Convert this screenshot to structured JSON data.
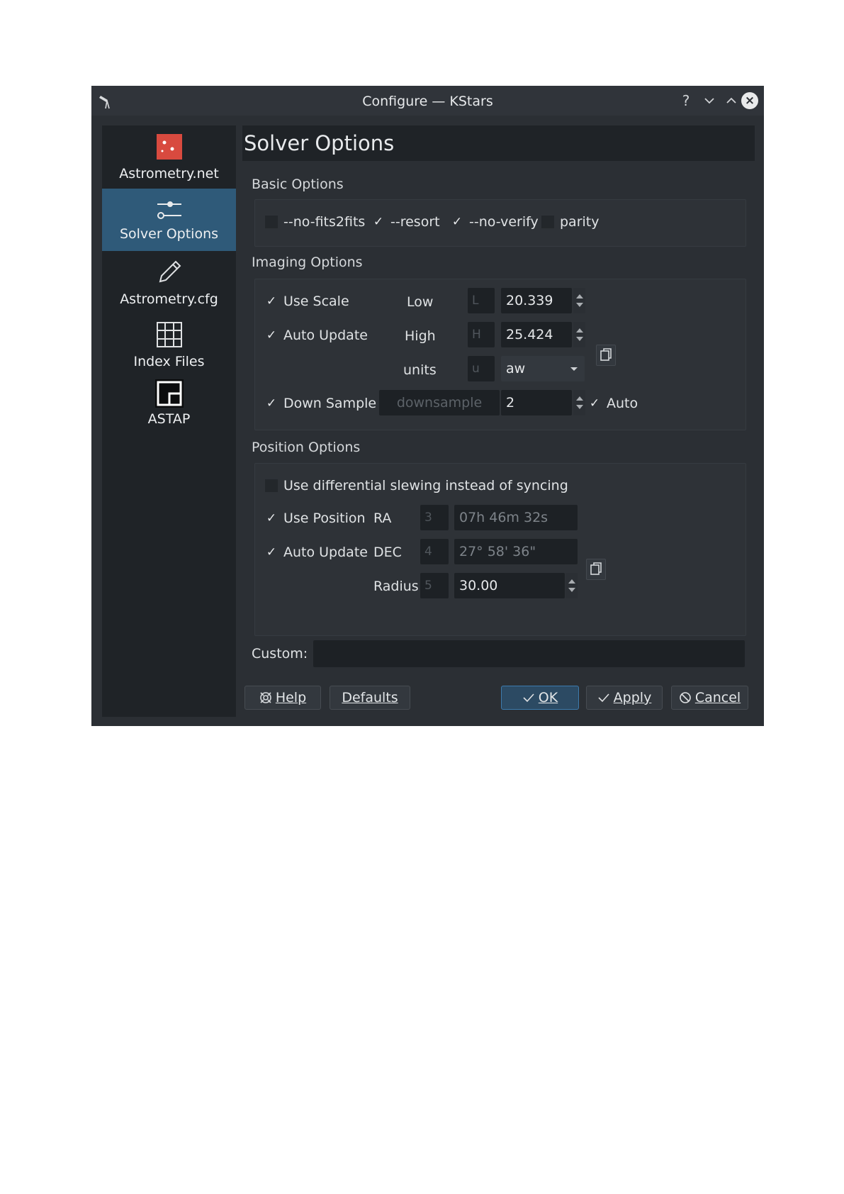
{
  "window": {
    "title": "Configure — KStars"
  },
  "titlebar": {
    "help_glyph": "?",
    "minimize_glyph": "⌄",
    "maximize_glyph": "⌃",
    "close_glyph": "×"
  },
  "sidebar": {
    "items": [
      {
        "label": "Astrometry.net",
        "icon": "astrometry-icon",
        "active": false
      },
      {
        "label": "Solver Options",
        "icon": "sliders-icon",
        "active": true
      },
      {
        "label": "Astrometry.cfg",
        "icon": "pencil-icon",
        "active": false
      },
      {
        "label": "Index Files",
        "icon": "grid-icon",
        "active": false
      },
      {
        "label": "ASTAP",
        "icon": "astap-icon",
        "active": false
      }
    ]
  },
  "page": {
    "title": "Solver Options"
  },
  "basic": {
    "title": "Basic Options",
    "options": [
      {
        "label": "--no-fits2fits",
        "checked": false
      },
      {
        "label": "--resort",
        "checked": true
      },
      {
        "label": "--no-verify",
        "checked": true
      },
      {
        "label": "parity",
        "checked": false
      }
    ]
  },
  "imaging": {
    "title": "Imaging Options",
    "use_scale": {
      "label": "Use Scale",
      "checked": true
    },
    "auto_update": {
      "label": "Auto Update",
      "checked": true
    },
    "down_sample": {
      "label": "Down Sample",
      "checked": true
    },
    "low": {
      "label": "Low",
      "key": "L",
      "value": "20.339"
    },
    "high": {
      "label": "High",
      "key": "H",
      "value": "25.424"
    },
    "units": {
      "label": "units",
      "key": "u",
      "value": "aw"
    },
    "downsample": {
      "placeholder": "downsample",
      "value": "2"
    },
    "auto": {
      "label": "Auto",
      "checked": true
    }
  },
  "position": {
    "title": "Position Options",
    "differential": {
      "label": "Use differential slewing instead of syncing",
      "checked": false
    },
    "use_position": {
      "label": "Use Position",
      "checked": true
    },
    "auto_update": {
      "label": "Auto Update",
      "checked": true
    },
    "ra": {
      "label": "RA",
      "key": "3",
      "value": "07h 46m 32s"
    },
    "dec": {
      "label": "DEC",
      "key": "4",
      "value": "27° 58' 36\""
    },
    "radius": {
      "label": "Radius",
      "key": "5",
      "value": "30.00"
    }
  },
  "custom": {
    "label": "Custom:",
    "value": ""
  },
  "buttons": {
    "help": "Help",
    "defaults": "Defaults",
    "ok": "OK",
    "apply": "Apply",
    "cancel": "Cancel"
  },
  "colors": {
    "window_bg": "#2b2f34",
    "sidebar_bg": "#1f2327",
    "active_item": "#2f5a79",
    "ok_border": "#3d7bad"
  }
}
